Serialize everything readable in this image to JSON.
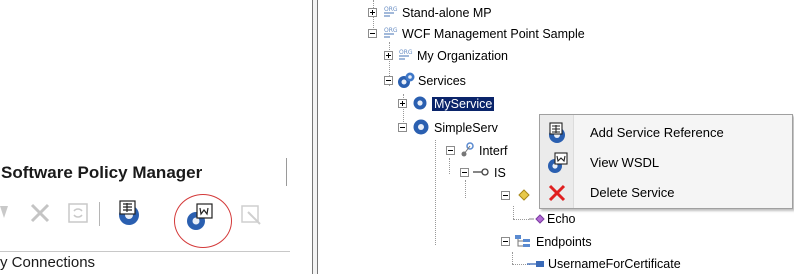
{
  "left_panel": {
    "title": "Software Policy Manager",
    "connections_label": "y Connections",
    "toolbar": {
      "buttons": [
        {
          "name": "partial-button-icon"
        },
        {
          "name": "delete-icon"
        },
        {
          "name": "refresh-icon"
        },
        {
          "name": "add-service-reference-icon"
        },
        {
          "name": "view-wsdl-icon",
          "highlighted": true
        },
        {
          "name": "disabled-tool-icon"
        }
      ]
    }
  },
  "tree": {
    "nodes": [
      {
        "label": "Stand-alone MP",
        "icon": "org-icon",
        "expander": "plus"
      },
      {
        "label": "WCF Management Point Sample",
        "icon": "org-icon",
        "expander": "minus"
      },
      {
        "label": "My Organization",
        "icon": "org-icon",
        "expander": "plus"
      },
      {
        "label": "Services",
        "icon": "services-icon",
        "expander": "minus"
      },
      {
        "label": "MyService",
        "icon": "service-gear-icon",
        "expander": "plus",
        "selected": true
      },
      {
        "label": "SimpleServ",
        "icon": "service-gear-icon",
        "expander": "minus"
      },
      {
        "label": "Interf",
        "icon": "interface-icon",
        "expander": "minus"
      },
      {
        "label": "IS",
        "icon": "interface-node-icon",
        "expander": "minus"
      },
      {
        "label": "",
        "icon": "operation-diamond-icon",
        "expander": "minus"
      },
      {
        "label": "Echo",
        "icon": "echo-operation-icon",
        "expander": "none"
      },
      {
        "label": "Endpoints",
        "icon": "endpoints-icon",
        "expander": "minus"
      },
      {
        "label": "UsernameForCertificate",
        "icon": "endpoint-icon",
        "expander": "none"
      }
    ]
  },
  "context_menu": {
    "items": [
      {
        "label": "Add Service Reference",
        "icon": "add-service-reference-icon"
      },
      {
        "label": "View WSDL",
        "icon": "view-wsdl-icon"
      },
      {
        "label": "Delete Service",
        "icon": "delete-x-icon"
      }
    ]
  },
  "colors": {
    "selection": "#0a246a",
    "highlight_ellipse": "#d43a3a",
    "delete_red": "#e02020",
    "gear_blue": "#2a5fb0"
  }
}
